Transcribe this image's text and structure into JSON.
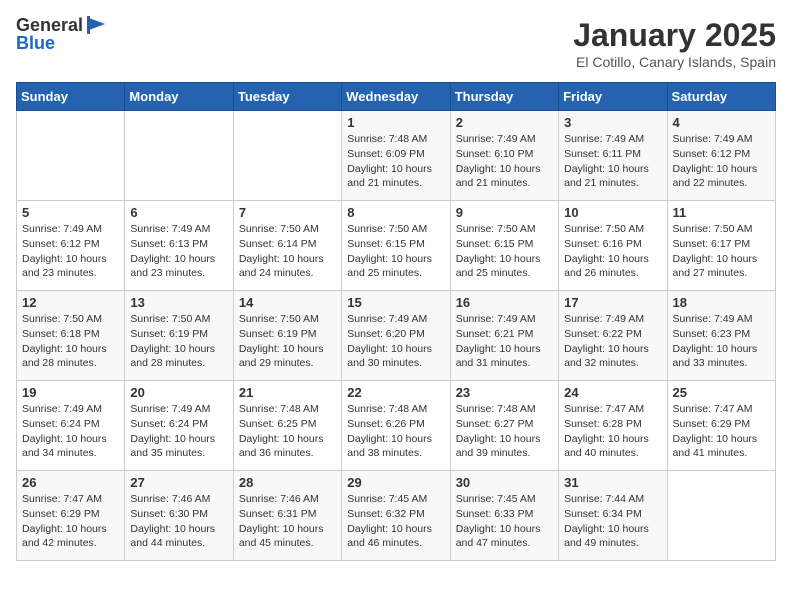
{
  "header": {
    "logo_general": "General",
    "logo_blue": "Blue",
    "month_title": "January 2025",
    "location": "El Cotillo, Canary Islands, Spain"
  },
  "days_of_week": [
    "Sunday",
    "Monday",
    "Tuesday",
    "Wednesday",
    "Thursday",
    "Friday",
    "Saturday"
  ],
  "weeks": [
    [
      {
        "day": "",
        "content": ""
      },
      {
        "day": "",
        "content": ""
      },
      {
        "day": "",
        "content": ""
      },
      {
        "day": "1",
        "content": "Sunrise: 7:48 AM\nSunset: 6:09 PM\nDaylight: 10 hours\nand 21 minutes."
      },
      {
        "day": "2",
        "content": "Sunrise: 7:49 AM\nSunset: 6:10 PM\nDaylight: 10 hours\nand 21 minutes."
      },
      {
        "day": "3",
        "content": "Sunrise: 7:49 AM\nSunset: 6:11 PM\nDaylight: 10 hours\nand 21 minutes."
      },
      {
        "day": "4",
        "content": "Sunrise: 7:49 AM\nSunset: 6:12 PM\nDaylight: 10 hours\nand 22 minutes."
      }
    ],
    [
      {
        "day": "5",
        "content": "Sunrise: 7:49 AM\nSunset: 6:12 PM\nDaylight: 10 hours\nand 23 minutes."
      },
      {
        "day": "6",
        "content": "Sunrise: 7:49 AM\nSunset: 6:13 PM\nDaylight: 10 hours\nand 23 minutes."
      },
      {
        "day": "7",
        "content": "Sunrise: 7:50 AM\nSunset: 6:14 PM\nDaylight: 10 hours\nand 24 minutes."
      },
      {
        "day": "8",
        "content": "Sunrise: 7:50 AM\nSunset: 6:15 PM\nDaylight: 10 hours\nand 25 minutes."
      },
      {
        "day": "9",
        "content": "Sunrise: 7:50 AM\nSunset: 6:15 PM\nDaylight: 10 hours\nand 25 minutes."
      },
      {
        "day": "10",
        "content": "Sunrise: 7:50 AM\nSunset: 6:16 PM\nDaylight: 10 hours\nand 26 minutes."
      },
      {
        "day": "11",
        "content": "Sunrise: 7:50 AM\nSunset: 6:17 PM\nDaylight: 10 hours\nand 27 minutes."
      }
    ],
    [
      {
        "day": "12",
        "content": "Sunrise: 7:50 AM\nSunset: 6:18 PM\nDaylight: 10 hours\nand 28 minutes."
      },
      {
        "day": "13",
        "content": "Sunrise: 7:50 AM\nSunset: 6:19 PM\nDaylight: 10 hours\nand 28 minutes."
      },
      {
        "day": "14",
        "content": "Sunrise: 7:50 AM\nSunset: 6:19 PM\nDaylight: 10 hours\nand 29 minutes."
      },
      {
        "day": "15",
        "content": "Sunrise: 7:49 AM\nSunset: 6:20 PM\nDaylight: 10 hours\nand 30 minutes."
      },
      {
        "day": "16",
        "content": "Sunrise: 7:49 AM\nSunset: 6:21 PM\nDaylight: 10 hours\nand 31 minutes."
      },
      {
        "day": "17",
        "content": "Sunrise: 7:49 AM\nSunset: 6:22 PM\nDaylight: 10 hours\nand 32 minutes."
      },
      {
        "day": "18",
        "content": "Sunrise: 7:49 AM\nSunset: 6:23 PM\nDaylight: 10 hours\nand 33 minutes."
      }
    ],
    [
      {
        "day": "19",
        "content": "Sunrise: 7:49 AM\nSunset: 6:24 PM\nDaylight: 10 hours\nand 34 minutes."
      },
      {
        "day": "20",
        "content": "Sunrise: 7:49 AM\nSunset: 6:24 PM\nDaylight: 10 hours\nand 35 minutes."
      },
      {
        "day": "21",
        "content": "Sunrise: 7:48 AM\nSunset: 6:25 PM\nDaylight: 10 hours\nand 36 minutes."
      },
      {
        "day": "22",
        "content": "Sunrise: 7:48 AM\nSunset: 6:26 PM\nDaylight: 10 hours\nand 38 minutes."
      },
      {
        "day": "23",
        "content": "Sunrise: 7:48 AM\nSunset: 6:27 PM\nDaylight: 10 hours\nand 39 minutes."
      },
      {
        "day": "24",
        "content": "Sunrise: 7:47 AM\nSunset: 6:28 PM\nDaylight: 10 hours\nand 40 minutes."
      },
      {
        "day": "25",
        "content": "Sunrise: 7:47 AM\nSunset: 6:29 PM\nDaylight: 10 hours\nand 41 minutes."
      }
    ],
    [
      {
        "day": "26",
        "content": "Sunrise: 7:47 AM\nSunset: 6:29 PM\nDaylight: 10 hours\nand 42 minutes."
      },
      {
        "day": "27",
        "content": "Sunrise: 7:46 AM\nSunset: 6:30 PM\nDaylight: 10 hours\nand 44 minutes."
      },
      {
        "day": "28",
        "content": "Sunrise: 7:46 AM\nSunset: 6:31 PM\nDaylight: 10 hours\nand 45 minutes."
      },
      {
        "day": "29",
        "content": "Sunrise: 7:45 AM\nSunset: 6:32 PM\nDaylight: 10 hours\nand 46 minutes."
      },
      {
        "day": "30",
        "content": "Sunrise: 7:45 AM\nSunset: 6:33 PM\nDaylight: 10 hours\nand 47 minutes."
      },
      {
        "day": "31",
        "content": "Sunrise: 7:44 AM\nSunset: 6:34 PM\nDaylight: 10 hours\nand 49 minutes."
      },
      {
        "day": "",
        "content": ""
      }
    ]
  ]
}
